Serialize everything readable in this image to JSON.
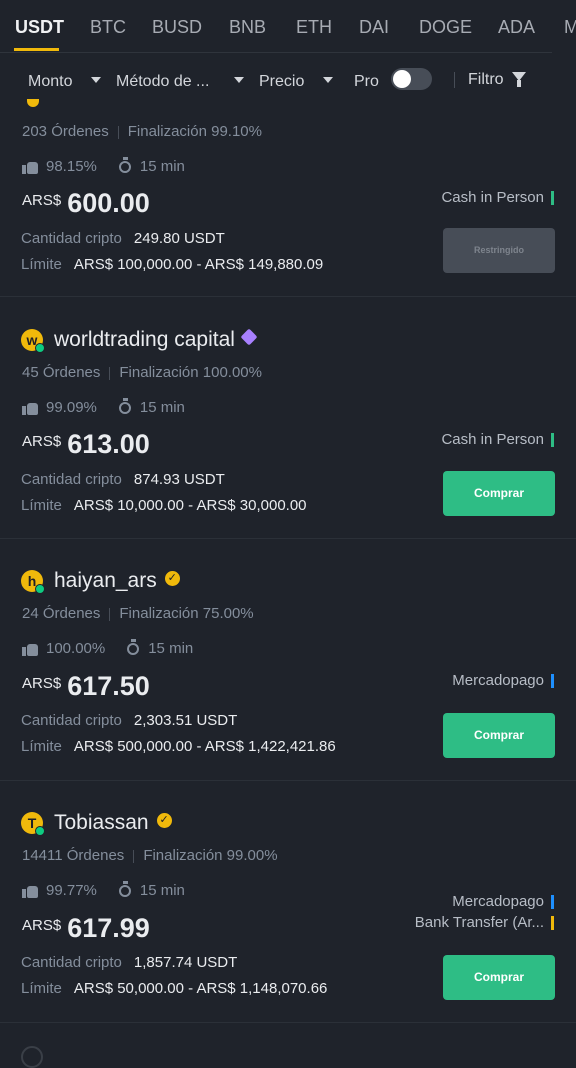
{
  "tabs": [
    "USDT",
    "BTC",
    "BUSD",
    "BNB",
    "ETH",
    "DAI",
    "DOGE",
    "ADA",
    "M"
  ],
  "active_tab": "USDT",
  "filters": {
    "amount": "Monto",
    "payment_method": "Método de ...",
    "price": "Precio",
    "pro": "Pro",
    "filter": "Filtro"
  },
  "colors": {
    "accent": "#f0b90b",
    "buy": "#2ebd85",
    "cash_mark": "#2ebd85",
    "mercadopago_mark": "#1e90ff",
    "bank_mark": "#f0b90b"
  },
  "listings": [
    {
      "merchant": "",
      "orders": "203 Órdenes",
      "completion": "Finalización 99.10%",
      "positive": "98.15%",
      "time": "15 min",
      "currency": "ARS$",
      "price": "600.00",
      "crypto_label": "Cantidad cripto",
      "crypto_amount": "249.80 USDT",
      "limit_label": "Límite",
      "limit": "ARS$ 100,000.00 - ARS$ 149,880.09",
      "payments": [
        "Cash in Person"
      ],
      "button": "Restringido"
    },
    {
      "merchant": "worldtrading capital",
      "avatar": "w",
      "orders": "45 Órdenes",
      "completion": "Finalización 100.00%",
      "positive": "99.09%",
      "time": "15 min",
      "currency": "ARS$",
      "price": "613.00",
      "crypto_label": "Cantidad cripto",
      "crypto_amount": "874.93 USDT",
      "limit_label": "Límite",
      "limit": "ARS$ 10,000.00 - ARS$ 30,000.00",
      "payments": [
        "Cash in Person"
      ],
      "button": "Comprar"
    },
    {
      "merchant": "haiyan_ars",
      "avatar": "h",
      "orders": "24 Órdenes",
      "completion": "Finalización 75.00%",
      "positive": "100.00%",
      "time": "15 min",
      "currency": "ARS$",
      "price": "617.50",
      "crypto_label": "Cantidad cripto",
      "crypto_amount": "2,303.51 USDT",
      "limit_label": "Límite",
      "limit": "ARS$ 500,000.00 - ARS$ 1,422,421.86",
      "payments": [
        "Mercadopago"
      ],
      "button": "Comprar"
    },
    {
      "merchant": "Tobiassan",
      "avatar": "T",
      "orders": "14411 Órdenes",
      "completion": "Finalización 99.00%",
      "positive": "99.77%",
      "time": "15 min",
      "currency": "ARS$",
      "price": "617.99",
      "crypto_label": "Cantidad cripto",
      "crypto_amount": "1,857.74 USDT",
      "limit_label": "Límite",
      "limit": "ARS$ 50,000.00 - ARS$ 1,148,070.66",
      "payments": [
        "Mercadopago",
        "Bank Transfer (Ar..."
      ],
      "button": "Comprar"
    }
  ]
}
